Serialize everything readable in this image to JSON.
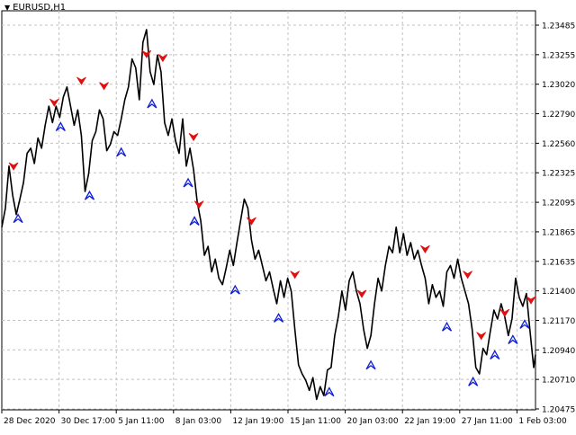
{
  "chart_data": {
    "type": "line",
    "title": "EURUSD,H1",
    "x_tick_labels": [
      "28 Dec 2020",
      "30 Dec 17:00",
      "5 Jan 11:00",
      "8 Jan 03:00",
      "12 Jan 19:00",
      "15 Jan 11:00",
      "20 Jan 03:00",
      "22 Jan 19:00",
      "27 Jan 11:00",
      "1 Feb 03:00"
    ],
    "y_tick_labels": [
      "1.23485",
      "1.23255",
      "1.23020",
      "1.22790",
      "1.22560",
      "1.22325",
      "1.22095",
      "1.21865",
      "1.21635",
      "1.21400",
      "1.21170",
      "1.20940",
      "1.20710",
      "1.20475"
    ],
    "ylim": [
      1.20475,
      1.23485
    ],
    "grid": true,
    "x_index_range": [
      0,
      590
    ],
    "series": [
      {
        "color": "#000000",
        "points": [
          [
            0,
            1.219
          ],
          [
            4,
            1.2205
          ],
          [
            8,
            1.2238
          ],
          [
            12,
            1.2215
          ],
          [
            16,
            1.22
          ],
          [
            20,
            1.2212
          ],
          [
            24,
            1.2225
          ],
          [
            28,
            1.2248
          ],
          [
            32,
            1.2252
          ],
          [
            36,
            1.224
          ],
          [
            40,
            1.226
          ],
          [
            44,
            1.2252
          ],
          [
            48,
            1.227
          ],
          [
            52,
            1.2285
          ],
          [
            56,
            1.2272
          ],
          [
            60,
            1.2285
          ],
          [
            64,
            1.2276
          ],
          [
            68,
            1.2292
          ],
          [
            72,
            1.23
          ],
          [
            76,
            1.2285
          ],
          [
            80,
            1.227
          ],
          [
            84,
            1.2282
          ],
          [
            88,
            1.2262
          ],
          [
            92,
            1.2218
          ],
          [
            96,
            1.2232
          ],
          [
            100,
            1.2258
          ],
          [
            104,
            1.2265
          ],
          [
            108,
            1.2282
          ],
          [
            112,
            1.2275
          ],
          [
            116,
            1.225
          ],
          [
            120,
            1.2255
          ],
          [
            124,
            1.2265
          ],
          [
            128,
            1.2262
          ],
          [
            132,
            1.2275
          ],
          [
            136,
            1.229
          ],
          [
            140,
            1.23
          ],
          [
            144,
            1.2322
          ],
          [
            148,
            1.2315
          ],
          [
            152,
            1.229
          ],
          [
            156,
            1.2335
          ],
          [
            160,
            1.2345
          ],
          [
            164,
            1.2312
          ],
          [
            168,
            1.2302
          ],
          [
            172,
            1.2325
          ],
          [
            176,
            1.2312
          ],
          [
            180,
            1.2272
          ],
          [
            184,
            1.2262
          ],
          [
            188,
            1.2275
          ],
          [
            192,
            1.2258
          ],
          [
            196,
            1.2248
          ],
          [
            200,
            1.2275
          ],
          [
            204,
            1.2238
          ],
          [
            208,
            1.2252
          ],
          [
            212,
            1.2235
          ],
          [
            216,
            1.221
          ],
          [
            220,
            1.2195
          ],
          [
            224,
            1.2168
          ],
          [
            228,
            1.2175
          ],
          [
            232,
            1.2155
          ],
          [
            236,
            1.2165
          ],
          [
            240,
            1.215
          ],
          [
            244,
            1.2145
          ],
          [
            248,
            1.2158
          ],
          [
            252,
            1.2172
          ],
          [
            256,
            1.216
          ],
          [
            260,
            1.2178
          ],
          [
            264,
            1.2195
          ],
          [
            268,
            1.2212
          ],
          [
            272,
            1.2205
          ],
          [
            276,
            1.218
          ],
          [
            280,
            1.2165
          ],
          [
            284,
            1.2172
          ],
          [
            288,
            1.216
          ],
          [
            292,
            1.2148
          ],
          [
            296,
            1.2155
          ],
          [
            300,
            1.2142
          ],
          [
            304,
            1.213
          ],
          [
            308,
            1.2148
          ],
          [
            312,
            1.2135
          ],
          [
            316,
            1.215
          ],
          [
            320,
            1.214
          ],
          [
            324,
            1.211
          ],
          [
            328,
            1.2082
          ],
          [
            332,
            1.2075
          ],
          [
            336,
            1.207
          ],
          [
            340,
            1.2062
          ],
          [
            344,
            1.2072
          ],
          [
            348,
            1.2055
          ],
          [
            352,
            1.2065
          ],
          [
            356,
            1.2058
          ],
          [
            360,
            1.2078
          ],
          [
            364,
            1.208
          ],
          [
            368,
            1.2105
          ],
          [
            372,
            1.212
          ],
          [
            376,
            1.214
          ],
          [
            380,
            1.2125
          ],
          [
            384,
            1.2148
          ],
          [
            388,
            1.2155
          ],
          [
            392,
            1.214
          ],
          [
            396,
            1.213
          ],
          [
            400,
            1.211
          ],
          [
            404,
            1.2095
          ],
          [
            408,
            1.2105
          ],
          [
            412,
            1.213
          ],
          [
            416,
            1.215
          ],
          [
            420,
            1.214
          ],
          [
            424,
            1.216
          ],
          [
            428,
            1.2175
          ],
          [
            432,
            1.217
          ],
          [
            436,
            1.219
          ],
          [
            440,
            1.217
          ],
          [
            444,
            1.2185
          ],
          [
            448,
            1.2168
          ],
          [
            452,
            1.2178
          ],
          [
            456,
            1.2165
          ],
          [
            460,
            1.2172
          ],
          [
            464,
            1.216
          ],
          [
            468,
            1.215
          ],
          [
            472,
            1.213
          ],
          [
            476,
            1.2145
          ],
          [
            480,
            1.2135
          ],
          [
            484,
            1.214
          ],
          [
            488,
            1.2128
          ],
          [
            492,
            1.2155
          ],
          [
            496,
            1.216
          ],
          [
            500,
            1.215
          ],
          [
            504,
            1.2165
          ],
          [
            508,
            1.215
          ],
          [
            512,
            1.214
          ],
          [
            516,
            1.213
          ],
          [
            520,
            1.211
          ],
          [
            524,
            1.208
          ],
          [
            528,
            1.2075
          ],
          [
            532,
            1.2095
          ],
          [
            536,
            1.209
          ],
          [
            540,
            1.2108
          ],
          [
            544,
            1.2125
          ],
          [
            548,
            1.2118
          ],
          [
            552,
            1.213
          ],
          [
            556,
            1.212
          ],
          [
            560,
            1.2105
          ],
          [
            564,
            1.2118
          ],
          [
            568,
            1.215
          ],
          [
            572,
            1.2135
          ],
          [
            576,
            1.2128
          ],
          [
            580,
            1.2138
          ],
          [
            584,
            1.2108
          ],
          [
            588,
            1.208
          ],
          [
            590,
            1.209
          ]
        ]
      }
    ],
    "sell_arrows": [
      {
        "x": 13,
        "y": 1.2235
      },
      {
        "x": 58,
        "y": 1.2285
      },
      {
        "x": 88,
        "y": 1.2302
      },
      {
        "x": 113,
        "y": 1.2298
      },
      {
        "x": 160,
        "y": 1.2323
      },
      {
        "x": 178,
        "y": 1.232
      },
      {
        "x": 212,
        "y": 1.2258
      },
      {
        "x": 218,
        "y": 1.2205
      },
      {
        "x": 276,
        "y": 1.2192
      },
      {
        "x": 324,
        "y": 1.215
      },
      {
        "x": 398,
        "y": 1.2135
      },
      {
        "x": 468,
        "y": 1.217
      },
      {
        "x": 515,
        "y": 1.215
      },
      {
        "x": 530,
        "y": 1.2102
      },
      {
        "x": 556,
        "y": 1.212
      },
      {
        "x": 585,
        "y": 1.213
      }
    ],
    "buy_arrows": [
      {
        "x": 18,
        "y": 1.22
      },
      {
        "x": 65,
        "y": 1.2272
      },
      {
        "x": 97,
        "y": 1.2218
      },
      {
        "x": 132,
        "y": 1.2252
      },
      {
        "x": 166,
        "y": 1.229
      },
      {
        "x": 206,
        "y": 1.2228
      },
      {
        "x": 213,
        "y": 1.2198
      },
      {
        "x": 258,
        "y": 1.2144
      },
      {
        "x": 306,
        "y": 1.2122
      },
      {
        "x": 362,
        "y": 1.2064
      },
      {
        "x": 408,
        "y": 1.2085
      },
      {
        "x": 492,
        "y": 1.2115
      },
      {
        "x": 521,
        "y": 1.2072
      },
      {
        "x": 545,
        "y": 1.2093
      },
      {
        "x": 565,
        "y": 1.2105
      },
      {
        "x": 578,
        "y": 1.2117
      }
    ],
    "colors": {
      "background": "#ffffff",
      "price_line": "#000000",
      "grid": "#c0c0c0",
      "sell_arrow": "#e01010",
      "buy_arrow": "#1020d8"
    }
  }
}
